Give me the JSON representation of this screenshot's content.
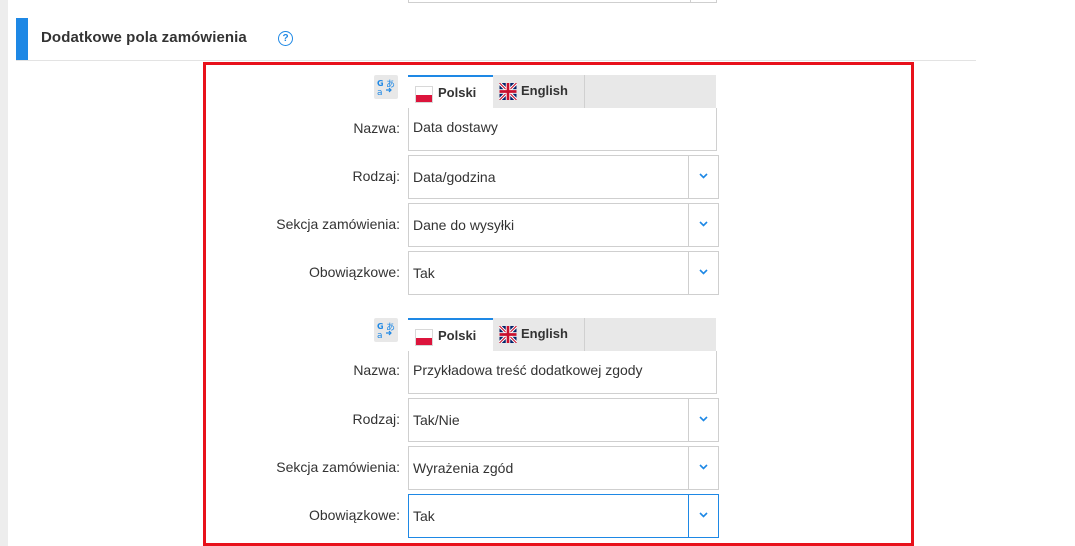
{
  "section": {
    "title": "Dodatkowe pola zamówienia",
    "help_glyph": "?"
  },
  "fields": [
    {
      "tabs": [
        {
          "label": "Polski",
          "active": true,
          "flag": "flag-pl-icon"
        },
        {
          "label": "English",
          "active": false,
          "flag": "flag-uk-icon"
        }
      ],
      "nazwa_label": "Nazwa:",
      "nazwa_value": "Data dostawy",
      "rodzaj_label": "Rodzaj:",
      "rodzaj_value": "Data/godzina",
      "sekcja_label": "Sekcja zamówienia:",
      "sekcja_value": "Dane do wysyłki",
      "obowiazkowe_label": "Obowiązkowe:",
      "obowiazkowe_value": "Tak"
    },
    {
      "tabs": [
        {
          "label": "Polski",
          "active": true,
          "flag": "flag-pl-icon"
        },
        {
          "label": "English",
          "active": false,
          "flag": "flag-uk-icon"
        }
      ],
      "nazwa_label": "Nazwa:",
      "nazwa_value": "Przykładowa treść dodatkowej zgody",
      "rodzaj_label": "Rodzaj:",
      "rodzaj_value": "Tak/Nie",
      "sekcja_label": "Sekcja zamówienia:",
      "sekcja_value": "Wyrażenia zgód",
      "obowiazkowe_label": "Obowiązkowe:",
      "obowiazkowe_value": "Tak"
    }
  ],
  "colors": {
    "accent": "#1e88e5",
    "highlight": "#e8111b"
  }
}
